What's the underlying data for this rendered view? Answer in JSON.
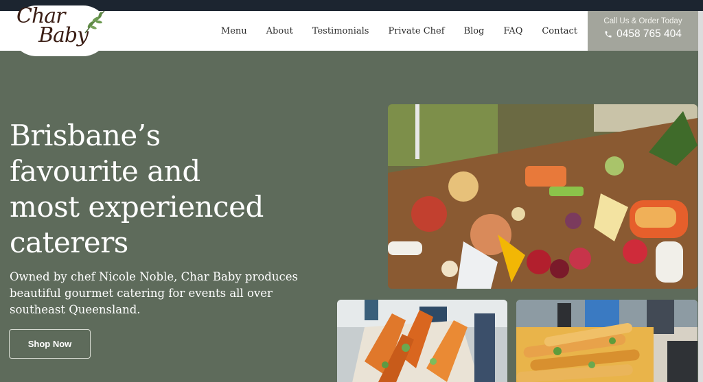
{
  "brand": {
    "logo_line1": "Char",
    "logo_line2": "Baby"
  },
  "nav": {
    "items": [
      {
        "label": "Menu",
        "name": "nav-menu"
      },
      {
        "label": "About",
        "name": "nav-about"
      },
      {
        "label": "Testimonials",
        "name": "nav-testimonials"
      },
      {
        "label": "Private Chef",
        "name": "nav-private-chef"
      },
      {
        "label": "Blog",
        "name": "nav-blog"
      },
      {
        "label": "FAQ",
        "name": "nav-faq"
      },
      {
        "label": "Contact",
        "name": "nav-contact"
      }
    ]
  },
  "cta": {
    "label": "Call Us & Order Today",
    "phone": "0458 765 404",
    "icon": "phone-icon"
  },
  "hero": {
    "title_lines": [
      "Brisbane’s",
      "favourite and",
      "most experienced",
      "caterers"
    ],
    "subtitle": "Owned by chef Nicole Noble, Char Baby produces beautiful gourmet catering for events all over southeast Queensland.",
    "button_label": "Shop Now"
  },
  "colors": {
    "background": "#5e6b5b",
    "header": "#ffffff",
    "cta_background": "#a3a59c",
    "top_strip": "#1c2530",
    "brand_text": "#3a1d14"
  }
}
